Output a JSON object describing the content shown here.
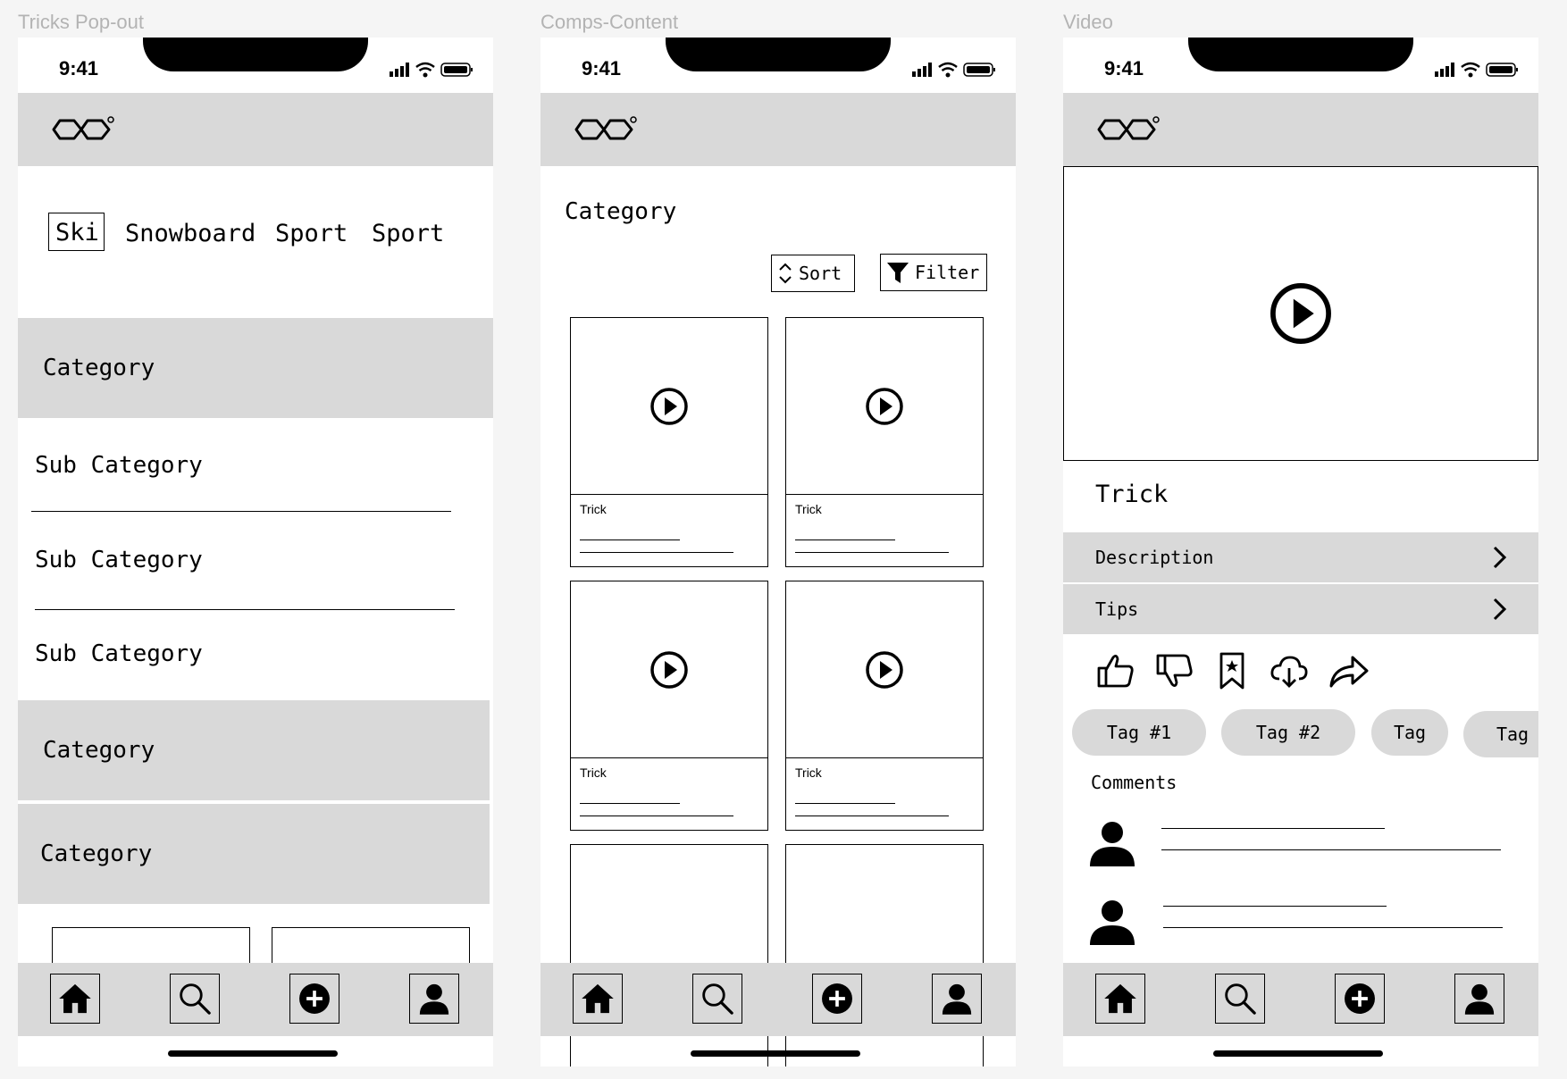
{
  "frames": {
    "tricks": "Tricks Pop-out",
    "comps": "Comps-Content",
    "video": "Video"
  },
  "status": {
    "time": "9:41"
  },
  "tricks_popout": {
    "sport_tabs": [
      "Ski",
      "Snowboard",
      "Sport",
      "Sport"
    ],
    "selected_tab": "Ski",
    "category_1": "Category",
    "sub_categories": [
      "Sub Category",
      "Sub Category",
      "Sub Category"
    ],
    "category_2": "Category",
    "category_3": "Category"
  },
  "comps_content": {
    "title": "Category",
    "sort_label": "Sort",
    "filter_label": "Filter",
    "cards": [
      "Trick",
      "Trick",
      "Trick",
      "Trick"
    ]
  },
  "video": {
    "trick_title": "Trick",
    "description_label": "Description",
    "tips_label": "Tips",
    "tags": [
      "Tag #1",
      "Tag #2",
      "Tag",
      "Tag"
    ],
    "comments_label": "Comments",
    "actions": [
      "thumbs-up-icon",
      "thumbs-down-icon",
      "bookmark-star-icon",
      "cloud-download-icon",
      "share-icon"
    ]
  },
  "tab_bar": [
    "home-icon",
    "search-icon",
    "add-icon",
    "profile-icon"
  ],
  "colors": {
    "header_gray": "#d9d9d9",
    "background": "#f5f5f5",
    "ink": "#000000"
  }
}
